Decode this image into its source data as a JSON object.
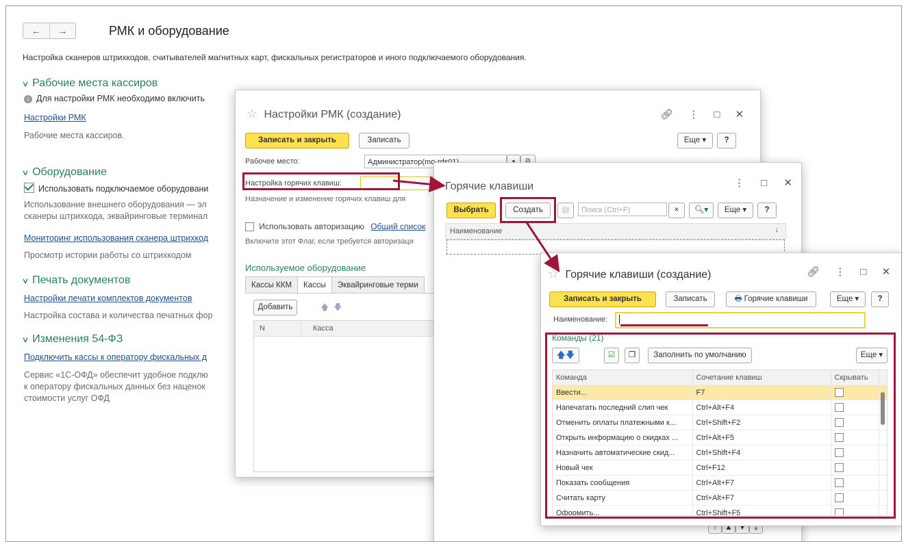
{
  "main": {
    "nav": {
      "back": "←",
      "forward": "→"
    },
    "title": "РМК и оборудование",
    "description": "Настройка сканеров штрихкодов, считывателей магнитных карт, фискальных регистраторов и иного подключаемого оборудования.",
    "sections": {
      "cashiers": {
        "header": "Рабочие места кассиров",
        "info": "Для настройки РМК необходимо включить",
        "link": "Настройки РМК",
        "note": "Рабочие места кассиров."
      },
      "equipment": {
        "header": "Оборудование",
        "checkbox": "Использовать подключаемое оборудовани",
        "note1": "Использование внешнего оборудования — эл",
        "note2": "сканеры штрихкода, эквайринговые терминал",
        "link": "Мониторинг использования сканера штрихкод",
        "note3": "Просмотр истории работы со штрихкодом"
      },
      "print": {
        "header": "Печать документов",
        "link": "Настройки печати комплектов документов",
        "note": "Настройка состава и количества печатных фор"
      },
      "law": {
        "header": "Изменения 54-ФЗ",
        "link": "Подключить кассы к оператору фискальных д",
        "note1": "Сервис «1С-ОФД» обеспечит удобное подклю",
        "note2": "к оператору фискальных данных без наценок",
        "note3": "стоимости услуг ОФД"
      }
    }
  },
  "rmk_window": {
    "title": "Настройки РМК (создание)",
    "save_close": "Записать и закрыть",
    "save": "Записать",
    "more": "Еще",
    "help": "?",
    "workplace_label": "Рабочее место:",
    "workplace_value": "Администратор(mo-rds01)",
    "hotkeys_label": "Настройка горячих клавиш:",
    "hotkeys_hint": "Назначение и изменение горячих клавиш для",
    "auth_checkbox": "Использовать авторизацию",
    "auth_link": "Общий список",
    "auth_hint": "Включите этот Флаг, если требуется авторизаци",
    "equipment_header": "Используемое оборудование",
    "tabs": [
      "Кассы ККМ",
      "Кассы",
      "Эквайринговые терми"
    ],
    "add_button": "Добавить",
    "col_n": "N",
    "col_kassa": "Касса"
  },
  "hotkeys_list_window": {
    "title": "Горячие клавиши",
    "select": "Выбрать",
    "create": "Создать",
    "search_placeholder": "Поиск (Ctrl+F)",
    "more": "Еще",
    "help": "?",
    "col_name": "Наименование"
  },
  "hotkeys_create_window": {
    "title": "Горячие клавиши (создание)",
    "save_close": "Записать и закрыть",
    "save": "Записать",
    "hotkeys_btn": "Горячие клавиши",
    "more": "Еще",
    "help": "?",
    "name_label": "Наименование:",
    "name_value": "",
    "commands_header": "Команды (21)",
    "fill_default": "Заполнить по умолчанию",
    "table_more": "Еще",
    "columns": [
      "Команда",
      "Сочетание клавиш",
      "Скрывать"
    ],
    "rows": [
      {
        "command": "Ввести...",
        "keys": "F7"
      },
      {
        "command": "Напечатать последний слип чек",
        "keys": "Ctrl+Alt+F4"
      },
      {
        "command": "Отменить оплаты платежными к...",
        "keys": "Ctrl+Shift+F2"
      },
      {
        "command": "Открыть информацию о скидках ...",
        "keys": "Ctrl+Alt+F5"
      },
      {
        "command": "Назначить автоматические скид...",
        "keys": "Ctrl+Shift+F4"
      },
      {
        "command": "Новый чек",
        "keys": "Ctrl+F12"
      },
      {
        "command": "Показать сообщения",
        "keys": "Ctrl+Alt+F7"
      },
      {
        "command": "Считать карту",
        "keys": "Ctrl+Alt+F7"
      },
      {
        "command": "Оформить...",
        "keys": "Ctrl+Shift+F5"
      }
    ]
  },
  "colors": {
    "accent_yellow": "#ffe14f",
    "highlight_red": "#a0163a",
    "section_green": "#2a7f62",
    "link_blue": "#1f4f8a"
  }
}
